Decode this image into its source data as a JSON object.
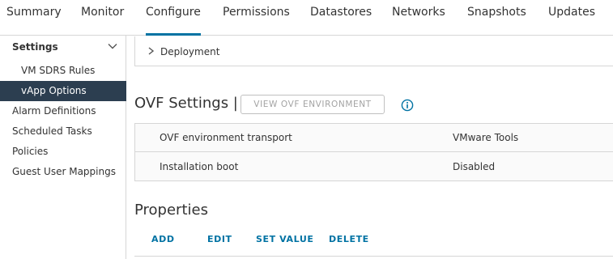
{
  "tabs": [
    {
      "label": "Summary"
    },
    {
      "label": "Monitor"
    },
    {
      "label": "Configure"
    },
    {
      "label": "Permissions"
    },
    {
      "label": "Datastores"
    },
    {
      "label": "Networks"
    },
    {
      "label": "Snapshots"
    },
    {
      "label": "Updates"
    }
  ],
  "sidebar": {
    "header": "Settings",
    "items": [
      {
        "label": "VM SDRS Rules"
      },
      {
        "label": "vApp Options"
      },
      {
        "label": "Alarm Definitions"
      },
      {
        "label": "Scheduled Tasks"
      },
      {
        "label": "Policies"
      },
      {
        "label": "Guest User Mappings"
      }
    ]
  },
  "main": {
    "deployment_label": "Deployment",
    "ovf": {
      "title": "OVF Settings |",
      "view_button": "VIEW OVF ENVIRONMENT",
      "rows": [
        {
          "key": "OVF environment transport",
          "value": "VMware Tools"
        },
        {
          "key": "Installation boot",
          "value": "Disabled"
        }
      ]
    },
    "properties": {
      "title": "Properties",
      "actions": {
        "add": "ADD",
        "edit": "EDIT",
        "set_value": "SET VALUE",
        "delete": "DELETE"
      }
    }
  },
  "colors": {
    "accent": "#0072a3",
    "selected_bg": "#2c3e50"
  }
}
